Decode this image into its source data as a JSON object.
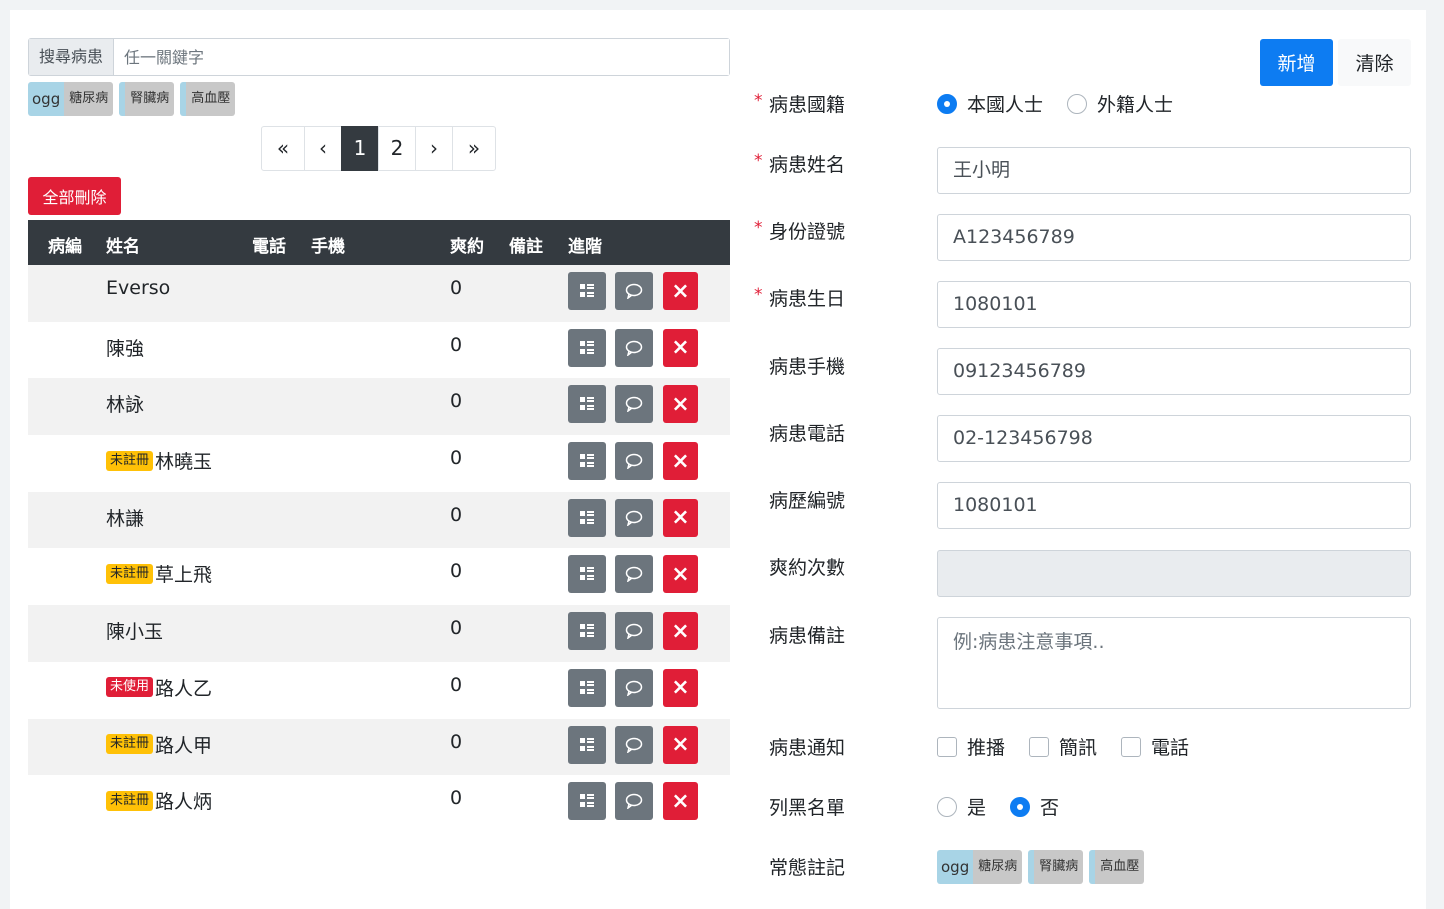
{
  "search": {
    "label": "搜尋病患",
    "placeholder": "任一關鍵字"
  },
  "tags": {
    "first": "ogg",
    "items": [
      "糖尿病",
      "腎臟病",
      "高血壓"
    ]
  },
  "pager": {
    "first": "«",
    "prev": "‹",
    "pages": [
      "1",
      "2"
    ],
    "next": "›",
    "last": "»",
    "active": "1"
  },
  "toolbar": {
    "delete_all": "全部刪除"
  },
  "table": {
    "headers": {
      "id": "病編",
      "name": "姓名",
      "phone": "電話",
      "mobile": "手機",
      "noshow": "爽約",
      "note": "備註",
      "advanced": "進階"
    },
    "rows": [
      {
        "badge": "",
        "name": "Everso",
        "noshow": "0"
      },
      {
        "badge": "",
        "name": "陳強",
        "noshow": "0"
      },
      {
        "badge": "",
        "name": "林詠",
        "noshow": "0"
      },
      {
        "badge": "未註冊",
        "badge_type": "warn",
        "name": "林曉玉",
        "noshow": "0"
      },
      {
        "badge": "",
        "name": "林謙",
        "noshow": "0"
      },
      {
        "badge": "未註冊",
        "badge_type": "warn",
        "name": "草上飛",
        "noshow": "0"
      },
      {
        "badge": "",
        "name": "陳小玉",
        "noshow": "0"
      },
      {
        "badge": "未使用",
        "badge_type": "danger",
        "name": "路人乙",
        "noshow": "0"
      },
      {
        "badge": "未註冊",
        "badge_type": "warn",
        "name": "路人甲",
        "noshow": "0"
      },
      {
        "badge": "未註冊",
        "badge_type": "warn",
        "name": "路人炳",
        "noshow": "0"
      }
    ],
    "delete_glyph": "×"
  },
  "form": {
    "add_label": "新增",
    "clear_label": "清除",
    "required_mark": "*",
    "nationality": {
      "label": "病患國籍",
      "options": [
        "本國人士",
        "外籍人士"
      ],
      "selected": "本國人士"
    },
    "name": {
      "label": "病患姓名",
      "value": "王小明"
    },
    "id_number": {
      "label": "身份證號",
      "value": "A123456789"
    },
    "birthday": {
      "label": "病患生日",
      "value": "1080101"
    },
    "mobile": {
      "label": "病患手機",
      "value": "09123456789"
    },
    "phone": {
      "label": "病患電話",
      "value": "02-123456798"
    },
    "record_no": {
      "label": "病歷編號",
      "value": "1080101"
    },
    "noshow_count": {
      "label": "爽約次數",
      "value": ""
    },
    "note": {
      "label": "病患備註",
      "placeholder": "例:病患注意事項.."
    },
    "notify": {
      "label": "病患通知",
      "options": [
        "推播",
        "簡訊",
        "電話"
      ]
    },
    "blacklist": {
      "label": "列黑名單",
      "options": [
        "是",
        "否"
      ],
      "selected": "否"
    },
    "tags_label": "常態註記"
  },
  "colors": {
    "primary": "#0d7cf2",
    "danger": "#e01e37",
    "warning": "#ffc107",
    "dark": "#343a40",
    "secondary": "#6c757d"
  }
}
